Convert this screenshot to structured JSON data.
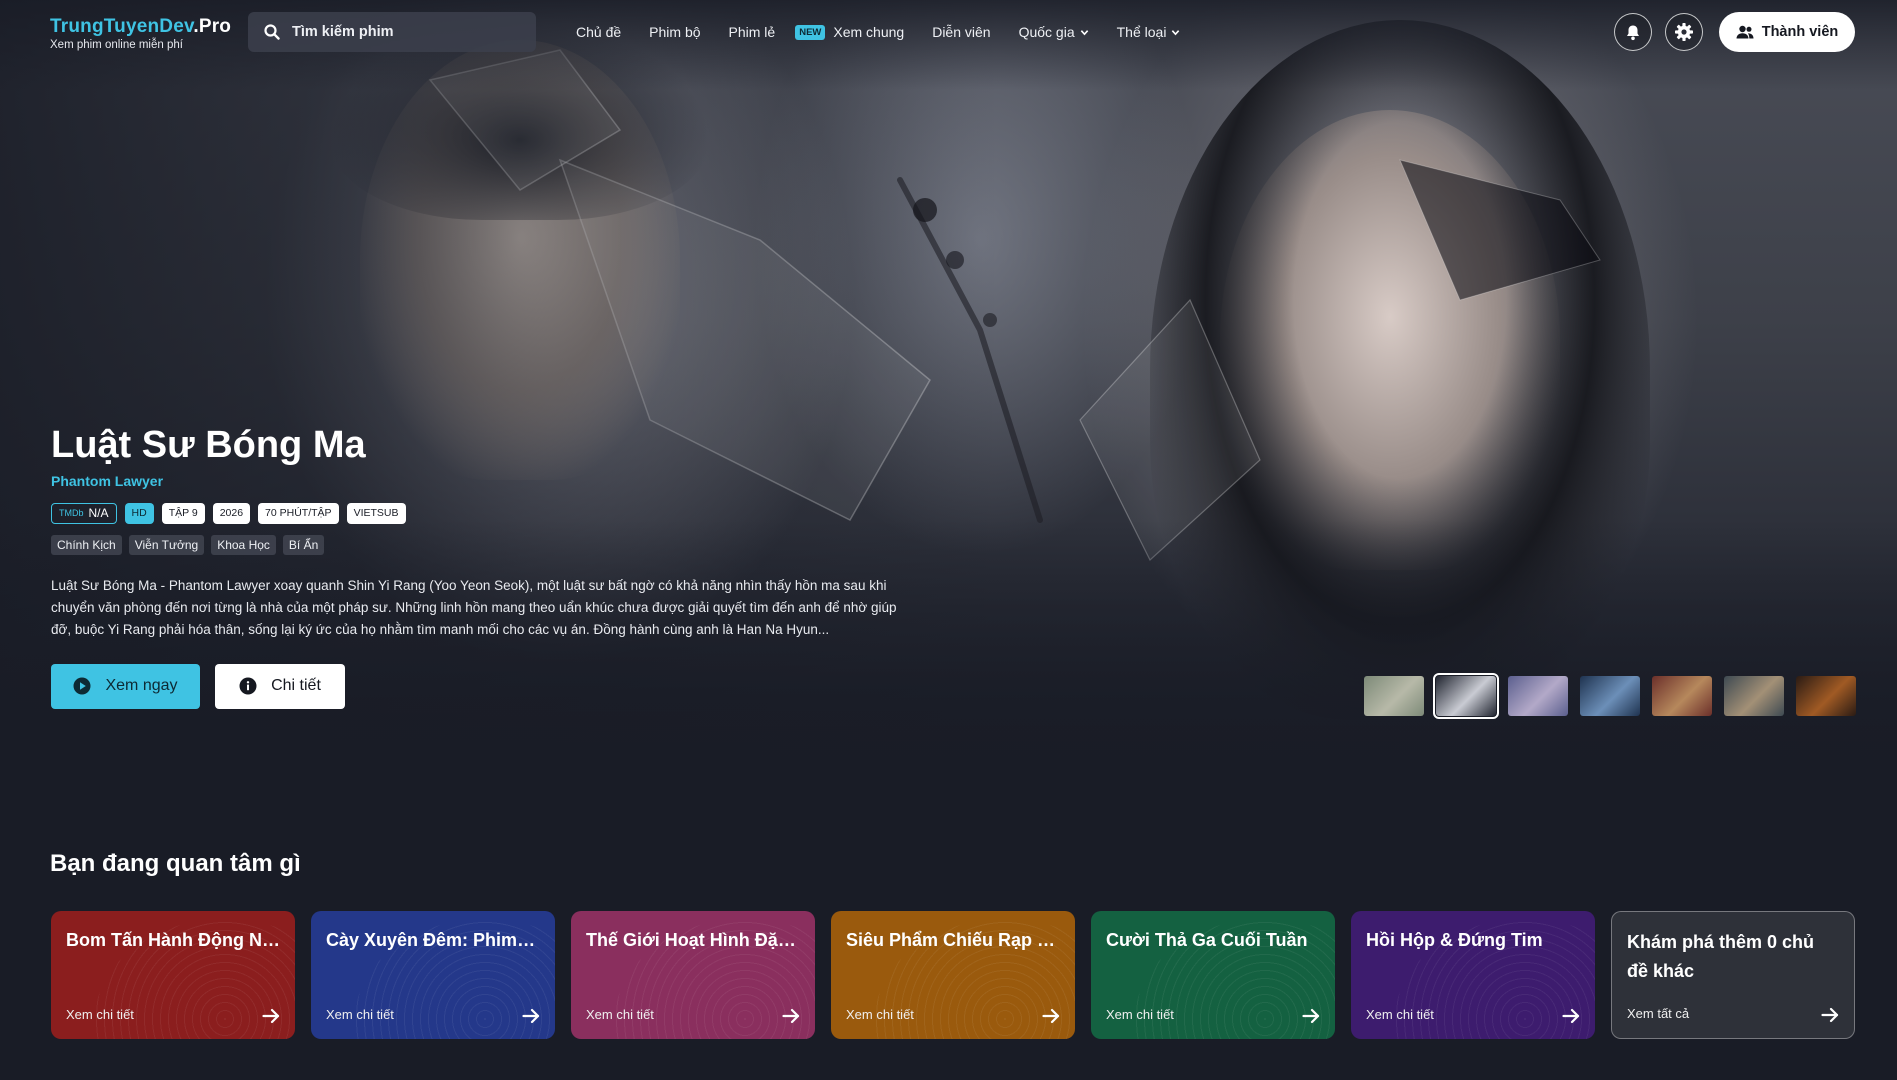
{
  "header": {
    "logo_main": "TrungTuyenDev",
    "logo_suffix": ".Pro",
    "logo_sub": "Xem phim online miễn phí",
    "search_placeholder": "Tìm kiếm phim",
    "nav": [
      {
        "label": "Chủ đề"
      },
      {
        "label": "Phim bộ"
      },
      {
        "label": "Phim lẻ"
      },
      {
        "label": "Xem chung",
        "badge": "NEW"
      },
      {
        "label": "Diễn viên"
      },
      {
        "label": "Quốc gia",
        "dropdown": true
      },
      {
        "label": "Thể loại",
        "dropdown": true
      }
    ],
    "bell_icon": "bell-icon",
    "settings_icon": "gear-icon",
    "member_label": "Thành viên"
  },
  "hero": {
    "title": "Luật Sư Bóng Ma",
    "original_title": "Phantom Lawyer",
    "tags": {
      "tmdb_label": "TMDb",
      "tmdb_value": "N/A",
      "quality": "HD",
      "episode": "TẬP 9",
      "year": "2026",
      "duration": "70 PHÚT/TẬP",
      "language": "VIETSUB"
    },
    "genres": [
      "Chính Kịch",
      "Viễn Tưởng",
      "Khoa Học",
      "Bí Ẩn"
    ],
    "description": "Luật Sư Bóng Ma - Phantom Lawyer xoay quanh Shin Yi Rang (Yoo Yeon Seok), một luật sư bất ngờ có khả năng nhìn thấy hồn ma sau khi chuyển văn phòng đến nơi từng là nhà của một pháp sư. Những linh hồn mang theo uẩn khúc chưa được giải quyết tìm đến anh để nhờ giúp đỡ, buộc Yi Rang phải hóa thân, sống lại ký ức của họ nhằm tìm manh mối cho các vụ án. Đồng hành cùng anh là Han Na Hyun...",
    "watch_label": "Xem ngay",
    "detail_label": "Chi tiết",
    "thumbnails": [
      {
        "colors": [
          "#7d8a78",
          "#b7b9a8"
        ]
      },
      {
        "colors": [
          "#20242f",
          "#c9cbd3"
        ],
        "active": true
      },
      {
        "colors": [
          "#5b5f8e",
          "#b3a9c8"
        ]
      },
      {
        "colors": [
          "#1f3350",
          "#6c8fb8"
        ]
      },
      {
        "colors": [
          "#6b2f2a",
          "#b6885c"
        ]
      },
      {
        "colors": [
          "#3e4a52",
          "#a39076"
        ]
      },
      {
        "colors": [
          "#2a1b14",
          "#a05a24"
        ]
      }
    ]
  },
  "topics": {
    "section_title": "Bạn đang quan tâm gì",
    "cards": [
      {
        "title": "Bom Tấn Hành Động Nghẹt Thở",
        "link": "Xem chi tiết",
        "color": "#8b1e1e"
      },
      {
        "title": "Cày Xuyên Đêm: Phim Bộ Gây Nghiện",
        "link": "Xem chi tiết",
        "color": "#24388a"
      },
      {
        "title": "Thế Giới Hoạt Hình Đặc Sắc",
        "link": "Xem chi tiết",
        "color": "#8a2f5e"
      },
      {
        "title": "Siêu Phẩm Chiếu Rạp Mới Nhất",
        "link": "Xem chi tiết",
        "color": "#9a5a0d"
      },
      {
        "title": "Cười Thả Ga Cuối Tuần",
        "link": "Xem chi tiết",
        "color": "#146141"
      },
      {
        "title": "Hồi Hộp & Đứng Tim",
        "link": "Xem chi tiết",
        "color": "#3d1c6e"
      }
    ],
    "more_title": "Khám phá thêm 0 chủ đề khác",
    "more_link": "Xem tất cả"
  }
}
